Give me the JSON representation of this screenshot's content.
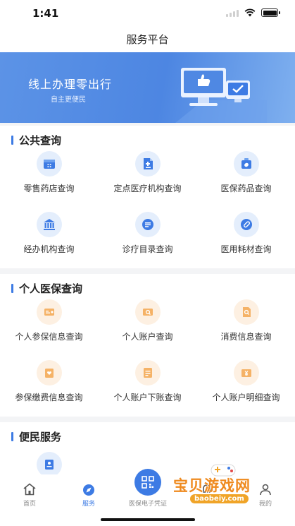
{
  "status": {
    "time": "1:41"
  },
  "nav": {
    "title": "服务平台"
  },
  "banner": {
    "title": "线上办理零出行",
    "subtitle": "自主更便民"
  },
  "sections": [
    {
      "title": "公共查询",
      "items": [
        {
          "label": "零售药店查询",
          "icon": "pharmacy-icon"
        },
        {
          "label": "定点医疗机构查询",
          "icon": "medical-institution-icon"
        },
        {
          "label": "医保药品查询",
          "icon": "medicine-box-icon"
        },
        {
          "label": "经办机构查询",
          "icon": "bank-building-icon"
        },
        {
          "label": "诊疗目录查询",
          "icon": "list-icon"
        },
        {
          "label": "医用耗材查询",
          "icon": "pill-icon"
        }
      ]
    },
    {
      "title": "个人医保查询",
      "items": [
        {
          "label": "个人参保信息查询",
          "icon": "insurance-card-icon"
        },
        {
          "label": "个人账户查询",
          "icon": "account-search-icon"
        },
        {
          "label": "消费信息查询",
          "icon": "consumption-search-icon"
        },
        {
          "label": "参保缴费信息查询",
          "icon": "payment-icon"
        },
        {
          "label": "个人账户下账查询",
          "icon": "ledger-icon"
        },
        {
          "label": "个人账户明细查询",
          "icon": "yuan-wallet-icon"
        }
      ]
    },
    {
      "title": "便民服务",
      "items": [
        {
          "label": "",
          "icon": "service-doc-icon"
        }
      ]
    }
  ],
  "tabs": [
    {
      "label": "首页",
      "icon": "home-icon"
    },
    {
      "label": "服务",
      "icon": "service-icon",
      "active": true
    },
    {
      "label": "医保电子凭证",
      "icon": "qr-code-icon"
    },
    {
      "label": "",
      "icon": "notification-icon"
    },
    {
      "label": "我的",
      "icon": "profile-icon"
    }
  ],
  "watermark": {
    "title": "宝贝游戏网",
    "url": "baobeiy.com"
  },
  "colors": {
    "accent": "#3d7be4",
    "banner": "#5c93e6",
    "icon_bg_blue": "#e4eefc",
    "icon_bg_orange": "#fdf0e2",
    "icon_orange": "#f0a03a"
  }
}
